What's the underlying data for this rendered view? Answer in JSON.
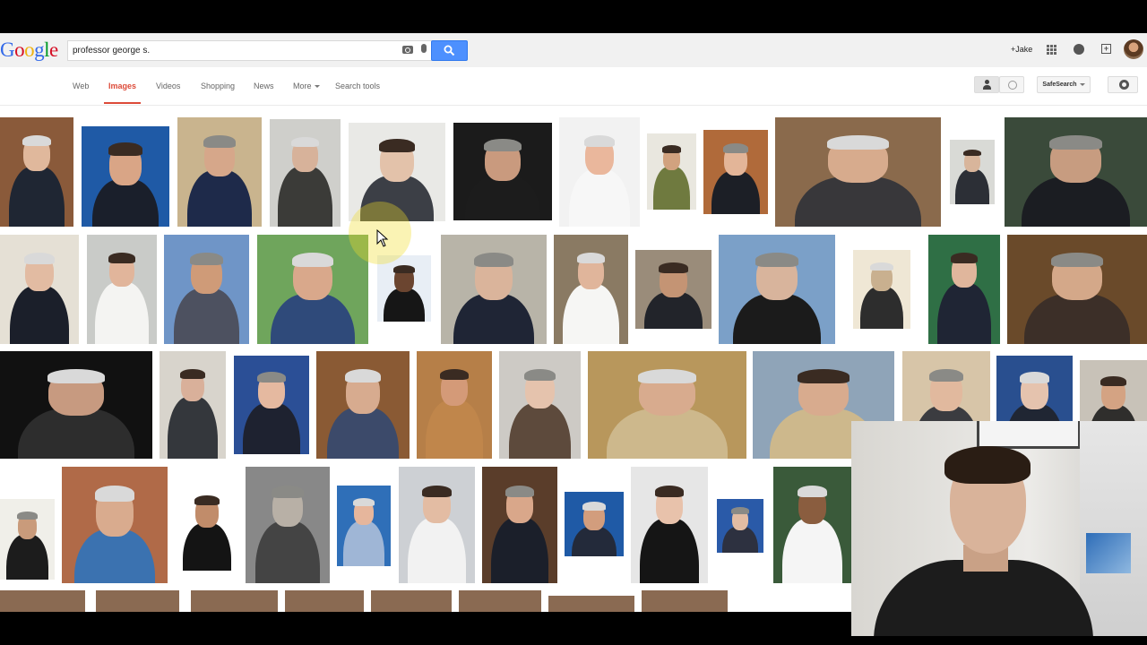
{
  "header": {
    "logo": {
      "G": "G",
      "o1": "o",
      "o2": "o",
      "g": "g",
      "l": "l",
      "e": "e"
    },
    "search": {
      "value": "professor george s."
    },
    "user_name": "+Jake"
  },
  "nav": {
    "tabs": [
      {
        "label": "Web"
      },
      {
        "label": "Images"
      },
      {
        "label": "Videos"
      },
      {
        "label": "Shopping"
      },
      {
        "label": "News"
      },
      {
        "label": "More"
      },
      {
        "label": "Search tools"
      }
    ],
    "safesearch_label": "SafeSearch"
  },
  "colors": {
    "accent_red": "#dd4b39",
    "search_blue": "#4d90fe"
  }
}
